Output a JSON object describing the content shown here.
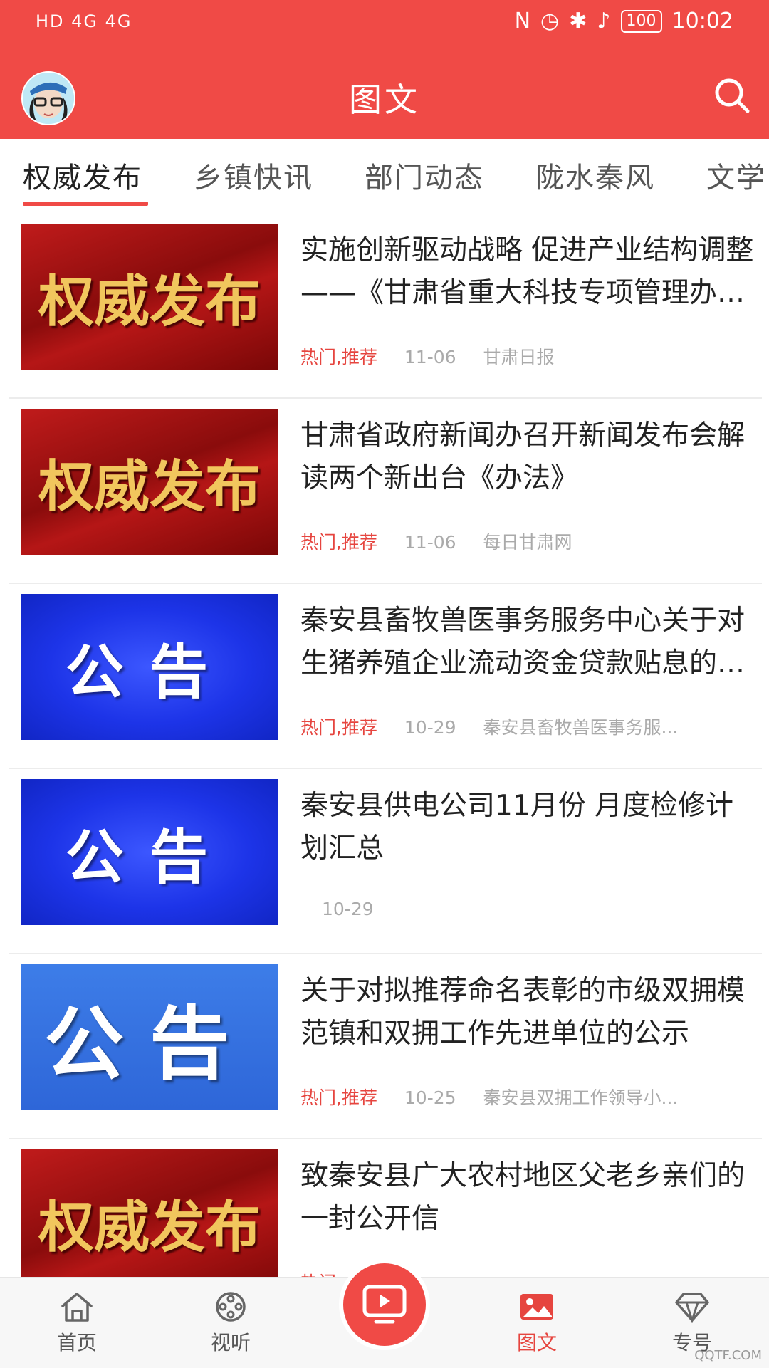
{
  "status_bar": {
    "left": "HD 4G 4G",
    "battery": "100",
    "time": "10:02"
  },
  "header": {
    "title": "图文"
  },
  "tabs": [
    {
      "label": "权威发布",
      "active": true
    },
    {
      "label": "乡镇快讯",
      "active": false
    },
    {
      "label": "部门动态",
      "active": false
    },
    {
      "label": "陇水秦风",
      "active": false
    },
    {
      "label": "文学",
      "active": false
    }
  ],
  "news": [
    {
      "thumb_text": "权威发布",
      "title": "实施创新驱动战略 促进产业结构调整 ——《甘肃省重大科技专项管理办法》解读",
      "tag": "热门,推荐",
      "date": "11-06",
      "source": "甘肃日报"
    },
    {
      "thumb_text": "权威发布",
      "title": "甘肃省政府新闻办召开新闻发布会解读两个新出台《办法》",
      "tag": "热门,推荐",
      "date": "11-06",
      "source": "每日甘肃网"
    },
    {
      "thumb_text": "公告",
      "title": "秦安县畜牧兽医事务服务中心关于对生猪养殖企业流动资金贷款贴息的公示",
      "tag": "热门,推荐",
      "date": "10-29",
      "source": "秦安县畜牧兽医事务服..."
    },
    {
      "thumb_text": "公告",
      "title": "秦安县供电公司11月份 月度检修计划汇总",
      "tag": "",
      "date": "10-29",
      "source": ""
    },
    {
      "thumb_text": "公告",
      "title": "关于对拟推荐命名表彰的市级双拥模范镇和双拥工作先进单位的公示",
      "tag": "热门,推荐",
      "date": "10-25",
      "source": "秦安县双拥工作领导小..."
    },
    {
      "thumb_text": "权威发布",
      "title": "致秦安县广大农村地区父老乡亲们的 一封公开信",
      "tag": "热门",
      "date": "",
      "source": ""
    }
  ],
  "bottom_nav": {
    "home": "首页",
    "video": "视听",
    "article": "图文",
    "account": "专号"
  },
  "watermark": "QQTF.COM",
  "colors": {
    "brand_red": "#f04a46",
    "tag_red": "#e6453f"
  }
}
